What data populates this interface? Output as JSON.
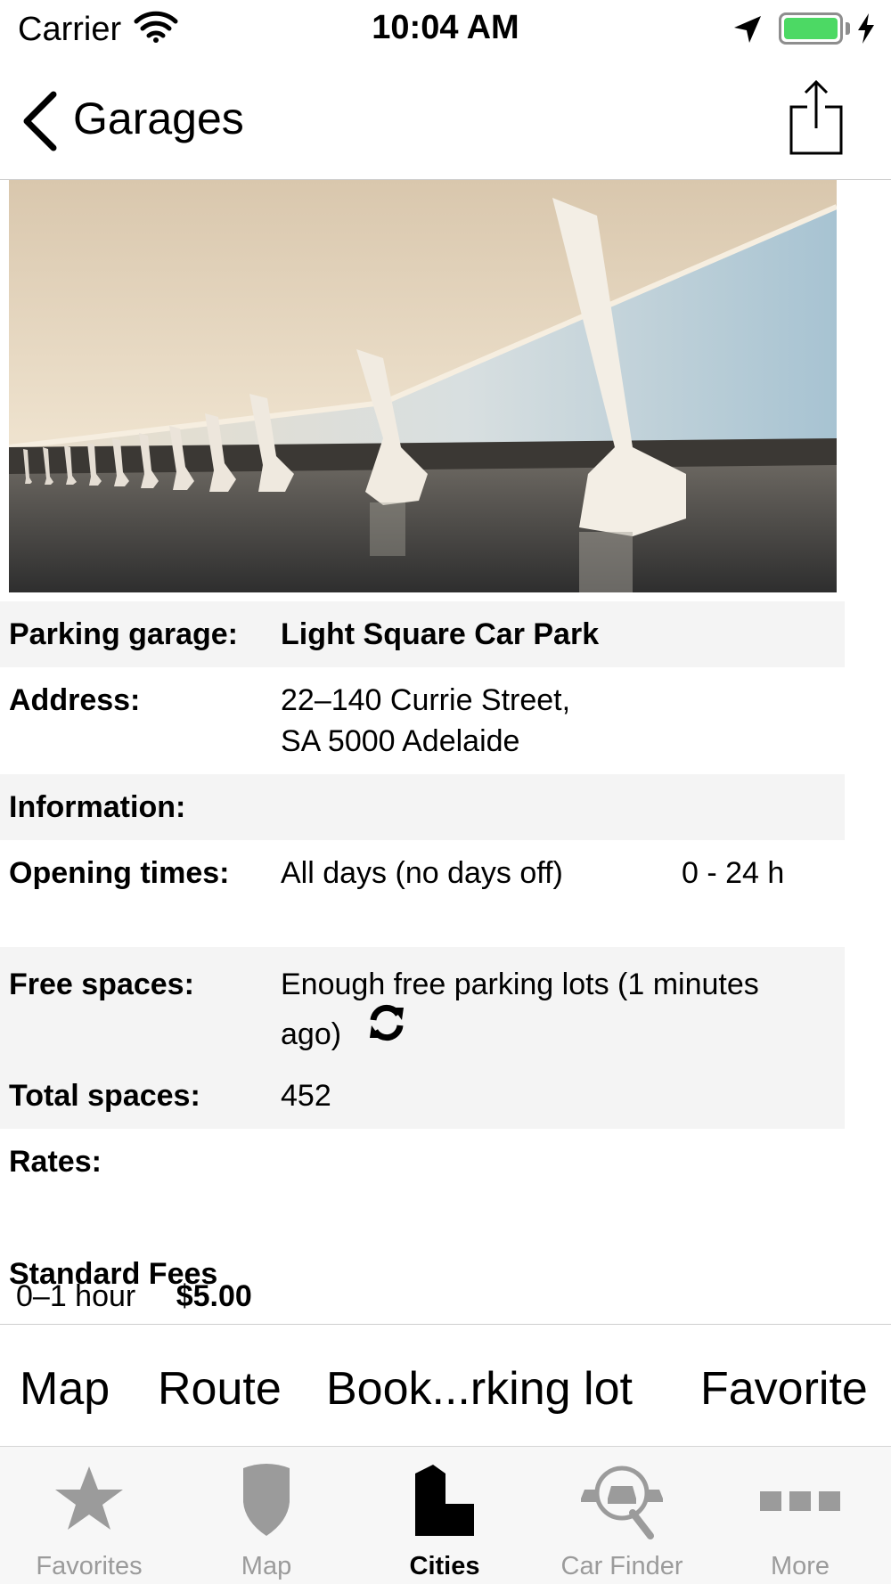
{
  "status_bar": {
    "carrier": "Carrier",
    "time": "10:04 AM",
    "battery_color": "#4cd964"
  },
  "nav": {
    "back_label": "Garages",
    "back_icon": "chevron-left-icon",
    "share_icon": "share-icon"
  },
  "details": {
    "parking_garage": {
      "label": "Parking garage:",
      "value": "Light Square Car Park"
    },
    "address": {
      "label": "Address:",
      "line1": "22–140 Currie Street,",
      "line2": "SA 5000 Adelaide"
    },
    "information": {
      "label": "Information:"
    },
    "opening_times": {
      "label": "Opening times:",
      "days": "All days (no days off)",
      "hours": "0 - 24 h"
    },
    "free_spaces": {
      "label": "Free spaces:",
      "line1": "Enough free parking lots (1 minutes",
      "line2": "ago)"
    },
    "total_spaces": {
      "label": "Total spaces:",
      "value": "452"
    },
    "rates": {
      "label": "Rates:"
    },
    "standard_fees": {
      "heading": "Standard Fees",
      "duration": "0–1 hour",
      "price": "$5.00"
    }
  },
  "actions": {
    "map": "Map",
    "route": "Route",
    "book": "Book...rking lot",
    "favorite": "Favorite"
  },
  "tabs": [
    {
      "label": "Favorites",
      "icon": "star-icon",
      "active": false
    },
    {
      "label": "Map",
      "icon": "shield-icon",
      "active": false
    },
    {
      "label": "Cities",
      "icon": "building-icon",
      "active": true
    },
    {
      "label": "Car Finder",
      "icon": "car-search-icon",
      "active": false
    },
    {
      "label": "More",
      "icon": "more-icon",
      "active": false
    }
  ]
}
